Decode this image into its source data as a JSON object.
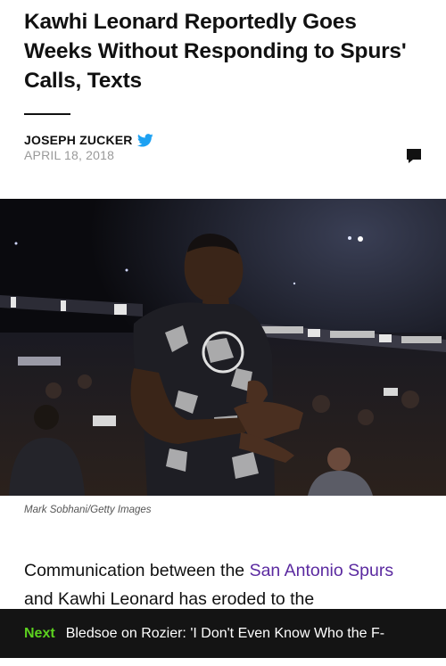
{
  "article": {
    "headline": "Kawhi Leonard Reportedly Goes Weeks Without Responding to Spurs' Calls, Texts",
    "author": "JOSEPH ZUCKER",
    "date": "APRIL 18, 2018",
    "photo_credit": "Mark Sobhani/Getty Images",
    "body": {
      "text_1": "Communication between the ",
      "link_1": "San Antonio Spurs",
      "text_2": " and Kawhi Leonard has eroded to the"
    }
  },
  "next": {
    "label": "Next",
    "title": "Bledsoe on Rozier: 'I Don't Even Know Who the F-"
  },
  "icons": {
    "author_social": "twitter-icon",
    "comments": "comment-icon"
  },
  "colors": {
    "link": "#5b2aa0",
    "next_label": "#5cd11f",
    "next_bar": "#141414",
    "twitter": "#1da1f2"
  }
}
